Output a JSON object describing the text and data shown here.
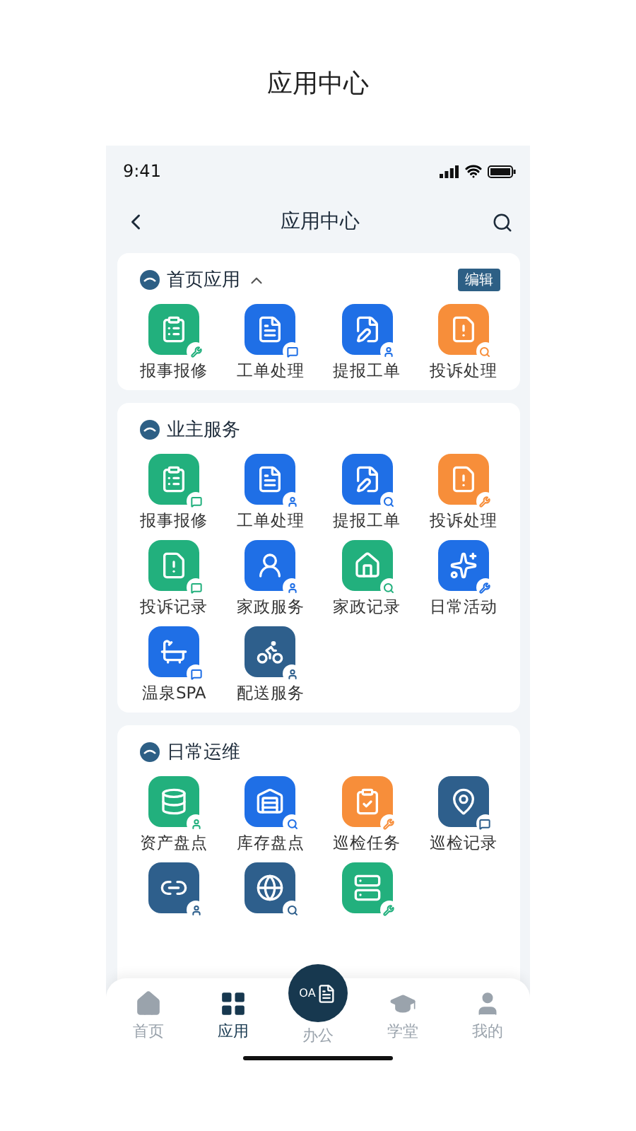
{
  "page_title": "应用中心",
  "status_bar": {
    "time": "9:41"
  },
  "nav_bar": {
    "title": "应用中心"
  },
  "sections": [
    {
      "title": "首页应用",
      "expanded": true,
      "action": "编辑",
      "apps": [
        {
          "label": "报事报修",
          "color": "#22b07d"
        },
        {
          "label": "工单处理",
          "color": "#1f6fe6"
        },
        {
          "label": "提报工单",
          "color": "#1f6fe6"
        },
        {
          "label": "投诉处理",
          "color": "#f78e3a"
        }
      ]
    },
    {
      "title": "业主服务",
      "apps": [
        {
          "label": "报事报修",
          "color": "#22b07d"
        },
        {
          "label": "工单处理",
          "color": "#1f6fe6"
        },
        {
          "label": "提报工单",
          "color": "#1f6fe6"
        },
        {
          "label": "投诉处理",
          "color": "#f78e3a"
        },
        {
          "label": "投诉记录",
          "color": "#22b07d"
        },
        {
          "label": "家政服务",
          "color": "#1f6fe6"
        },
        {
          "label": "家政记录",
          "color": "#22b07d"
        },
        {
          "label": "日常活动",
          "color": "#1f6fe6"
        },
        {
          "label": "温泉SPA",
          "color": "#1f6fe6"
        },
        {
          "label": "配送服务",
          "color": "#2e5f8c"
        }
      ]
    },
    {
      "title": "日常运维",
      "apps": [
        {
          "label": "资产盘点",
          "color": "#22b07d"
        },
        {
          "label": "库存盘点",
          "color": "#1f6fe6"
        },
        {
          "label": "巡检任务",
          "color": "#f78e3a"
        },
        {
          "label": "巡检记录",
          "color": "#2e5f8c"
        },
        {
          "color": "#2e5f8c"
        },
        {
          "color": "#2e5f8c"
        },
        {
          "color": "#22b07d"
        }
      ]
    }
  ],
  "tab_bar": [
    {
      "label": "首页",
      "selected": false,
      "kind": "tab"
    },
    {
      "label": "应用",
      "selected": true,
      "kind": "tab"
    },
    {
      "label": "办公",
      "selected": false,
      "kind": "center",
      "badge": "OA"
    },
    {
      "label": "学堂",
      "selected": false,
      "kind": "tab"
    },
    {
      "label": "我的",
      "selected": false,
      "kind": "tab"
    }
  ]
}
